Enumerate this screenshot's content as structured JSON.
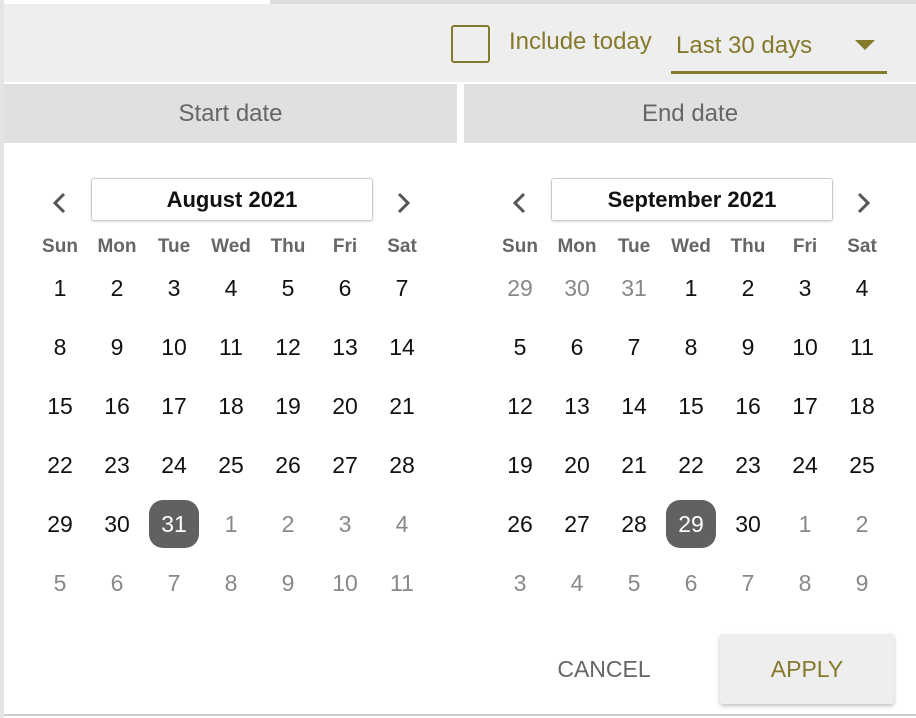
{
  "colors": {
    "accent": "#857a2c",
    "selected": "#616161"
  },
  "toolbar": {
    "include_today_label": "Include today",
    "include_today_checked": false,
    "range_select": "Last 30 days"
  },
  "headers": {
    "start": "Start date",
    "end": "End date"
  },
  "weekdays": [
    "Sun",
    "Mon",
    "Tue",
    "Wed",
    "Thu",
    "Fri",
    "Sat"
  ],
  "calendars": [
    {
      "month": "August 2021",
      "weeks": [
        [
          {
            "d": "1"
          },
          {
            "d": "2"
          },
          {
            "d": "3"
          },
          {
            "d": "4"
          },
          {
            "d": "5"
          },
          {
            "d": "6"
          },
          {
            "d": "7"
          }
        ],
        [
          {
            "d": "8"
          },
          {
            "d": "9"
          },
          {
            "d": "10"
          },
          {
            "d": "11"
          },
          {
            "d": "12"
          },
          {
            "d": "13"
          },
          {
            "d": "14"
          }
        ],
        [
          {
            "d": "15"
          },
          {
            "d": "16"
          },
          {
            "d": "17"
          },
          {
            "d": "18"
          },
          {
            "d": "19"
          },
          {
            "d": "20"
          },
          {
            "d": "21"
          }
        ],
        [
          {
            "d": "22"
          },
          {
            "d": "23"
          },
          {
            "d": "24"
          },
          {
            "d": "25"
          },
          {
            "d": "26"
          },
          {
            "d": "27"
          },
          {
            "d": "28"
          }
        ],
        [
          {
            "d": "29"
          },
          {
            "d": "30"
          },
          {
            "d": "31",
            "selected": true
          },
          {
            "d": "1",
            "other": true
          },
          {
            "d": "2",
            "other": true
          },
          {
            "d": "3",
            "other": true
          },
          {
            "d": "4",
            "other": true
          }
        ],
        [
          {
            "d": "5",
            "other": true
          },
          {
            "d": "6",
            "other": true
          },
          {
            "d": "7",
            "other": true
          },
          {
            "d": "8",
            "other": true
          },
          {
            "d": "9",
            "other": true
          },
          {
            "d": "10",
            "other": true
          },
          {
            "d": "11",
            "other": true
          }
        ]
      ]
    },
    {
      "month": "September 2021",
      "weeks": [
        [
          {
            "d": "29",
            "other": true
          },
          {
            "d": "30",
            "other": true
          },
          {
            "d": "31",
            "other": true
          },
          {
            "d": "1"
          },
          {
            "d": "2"
          },
          {
            "d": "3"
          },
          {
            "d": "4"
          }
        ],
        [
          {
            "d": "5"
          },
          {
            "d": "6"
          },
          {
            "d": "7"
          },
          {
            "d": "8"
          },
          {
            "d": "9"
          },
          {
            "d": "10"
          },
          {
            "d": "11"
          }
        ],
        [
          {
            "d": "12"
          },
          {
            "d": "13"
          },
          {
            "d": "14"
          },
          {
            "d": "15"
          },
          {
            "d": "16"
          },
          {
            "d": "17"
          },
          {
            "d": "18"
          }
        ],
        [
          {
            "d": "19"
          },
          {
            "d": "20"
          },
          {
            "d": "21"
          },
          {
            "d": "22"
          },
          {
            "d": "23"
          },
          {
            "d": "24"
          },
          {
            "d": "25"
          }
        ],
        [
          {
            "d": "26"
          },
          {
            "d": "27"
          },
          {
            "d": "28"
          },
          {
            "d": "29",
            "selected": true
          },
          {
            "d": "30"
          },
          {
            "d": "1",
            "other": true
          },
          {
            "d": "2",
            "other": true
          }
        ],
        [
          {
            "d": "3",
            "other": true
          },
          {
            "d": "4",
            "other": true
          },
          {
            "d": "5",
            "other": true
          },
          {
            "d": "6",
            "other": true
          },
          {
            "d": "7",
            "other": true
          },
          {
            "d": "8",
            "other": true
          },
          {
            "d": "9",
            "other": true
          }
        ]
      ]
    }
  ],
  "actions": {
    "cancel": "CANCEL",
    "apply": "APPLY"
  }
}
